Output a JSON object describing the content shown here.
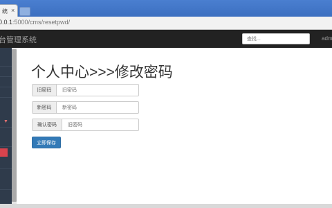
{
  "browser": {
    "tab_title": "统",
    "tab_close": "×",
    "url_host": "0.0.1",
    "url_path": ":5000/cms/resetpwd/"
  },
  "navbar": {
    "brand": "台管理系统",
    "search_placeholder": "查找...",
    "user": "adm"
  },
  "main": {
    "title": "个人中心>>>修改密码",
    "fields": [
      {
        "label": "旧密码",
        "placeholder": "旧密码"
      },
      {
        "label": "新密码",
        "placeholder": "新密码"
      },
      {
        "label": "确认密码",
        "placeholder": "旧密码"
      }
    ],
    "save_button": "立即保存"
  },
  "colors": {
    "navbar_bg": "#222222",
    "sidebar_bg": "#2f3b4b",
    "sidebar_active": "#d8434d",
    "primary_button": "#337ab7"
  }
}
